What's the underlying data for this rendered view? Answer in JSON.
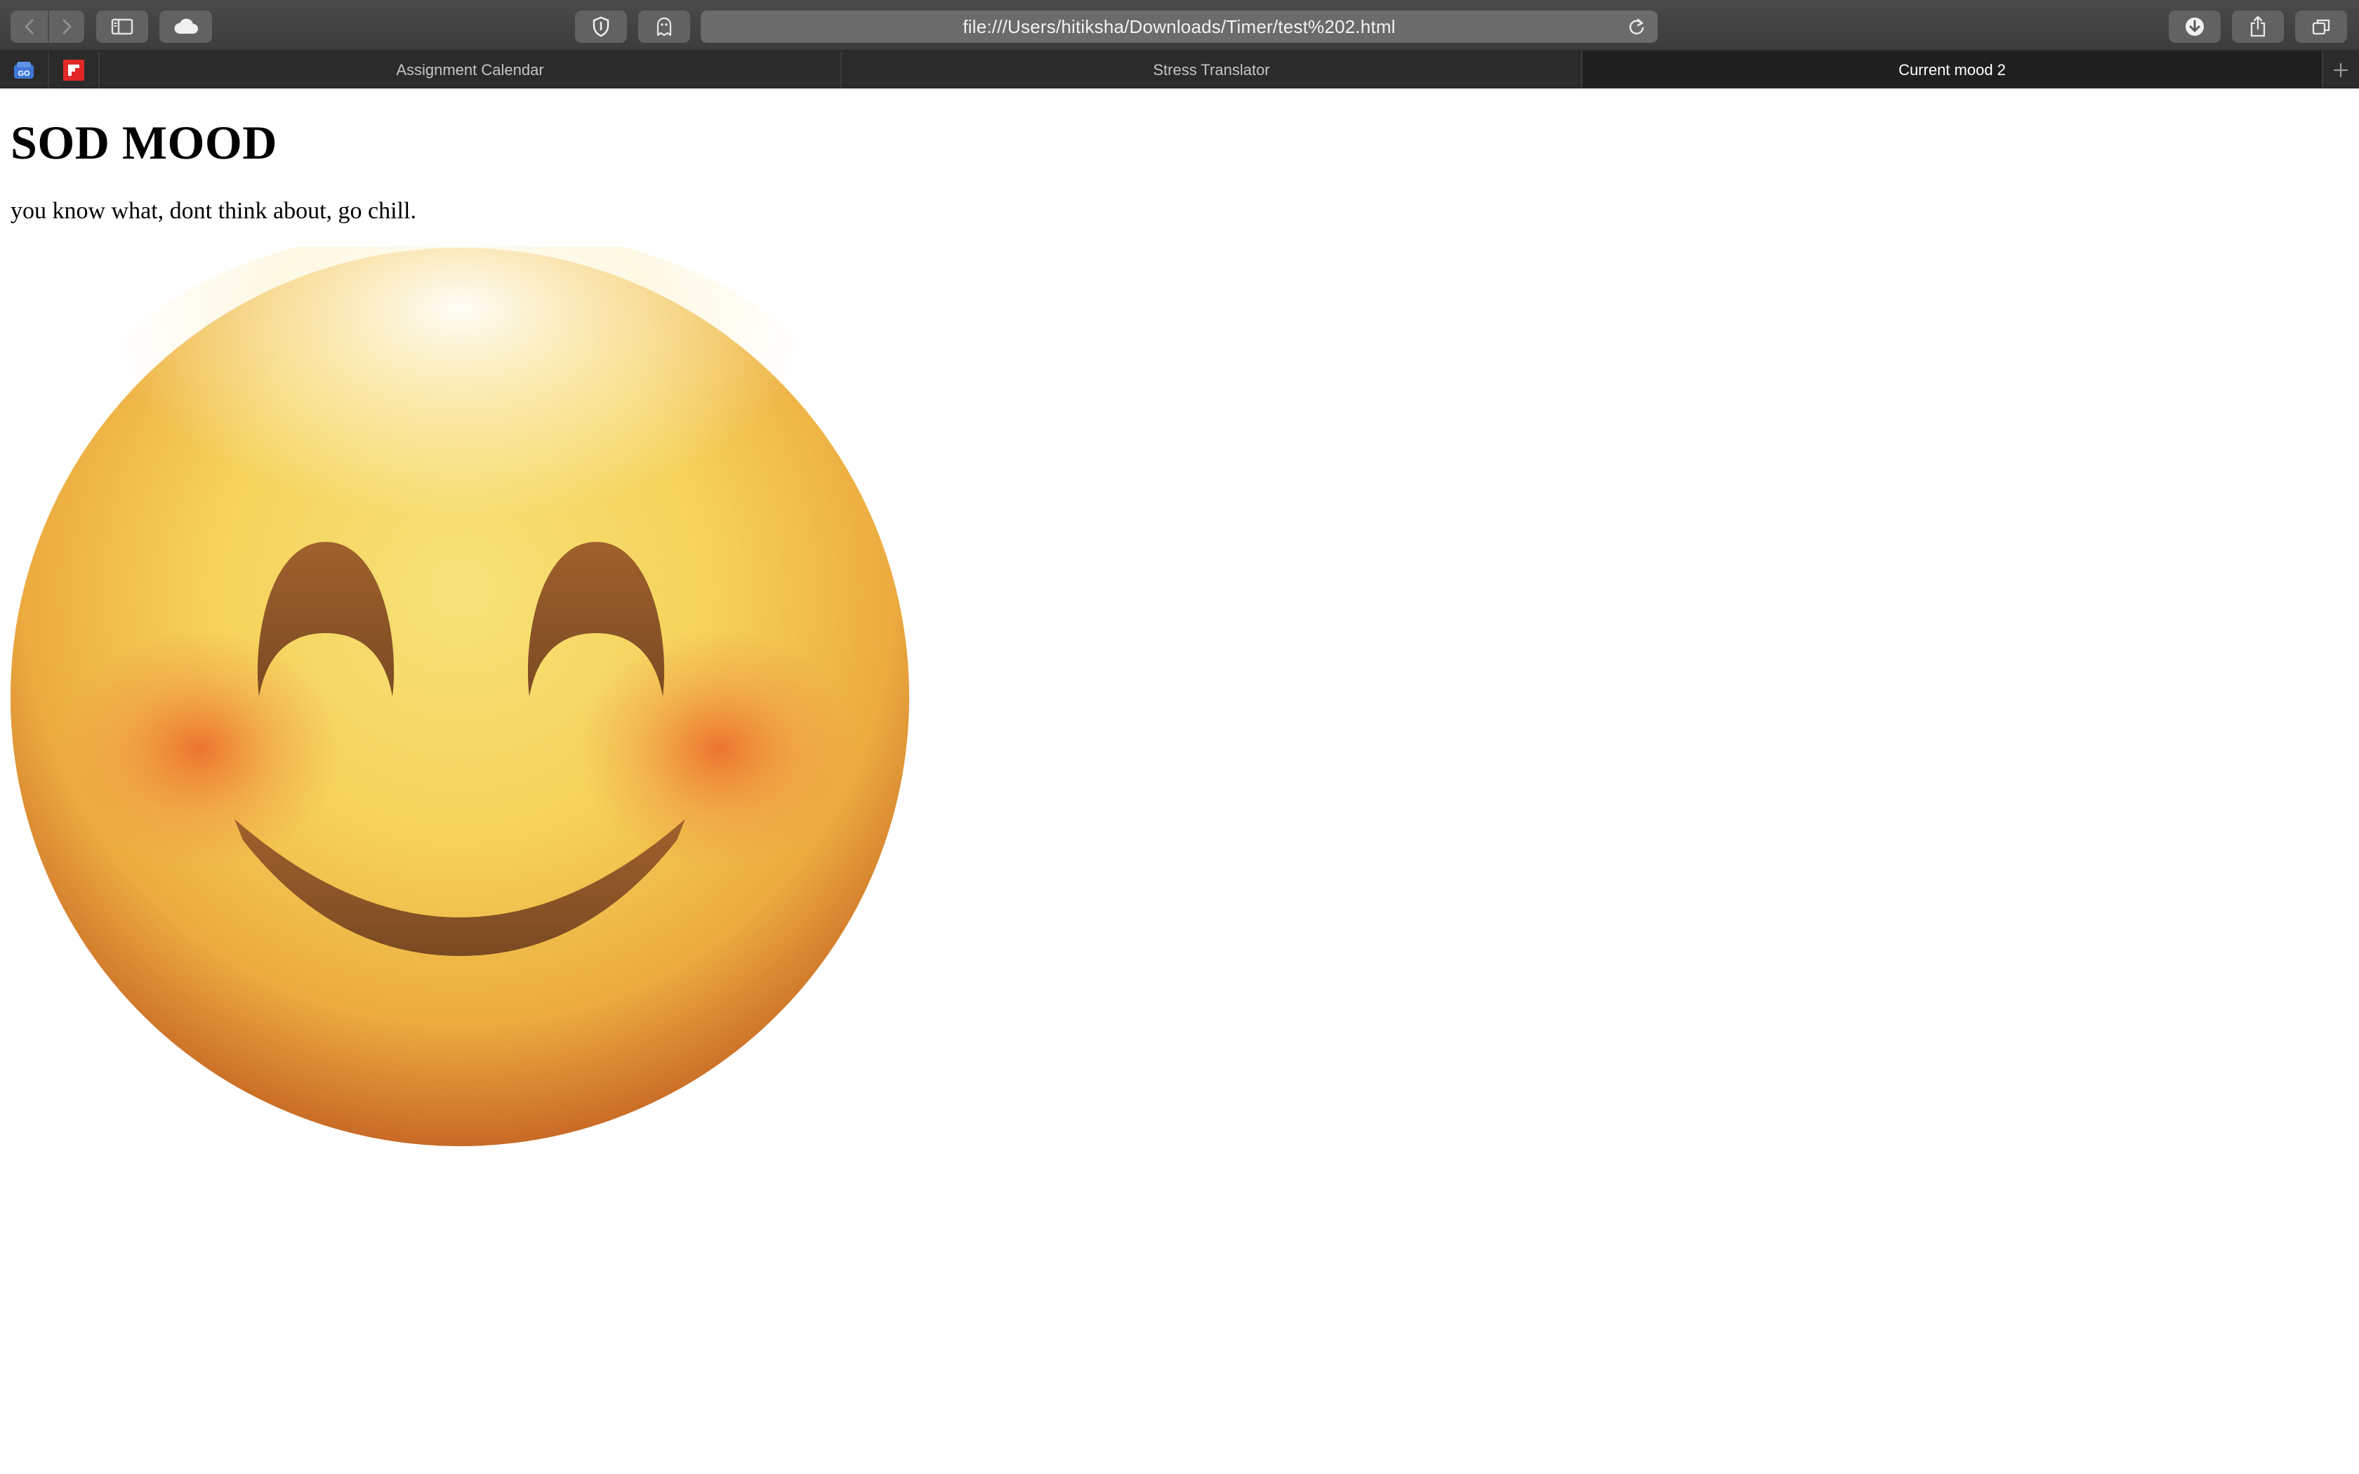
{
  "browser": {
    "url": "file:///Users/hitiksha/Downloads/Timer/test%202.html",
    "tabs": [
      {
        "label": "Assignment Calendar",
        "active": false
      },
      {
        "label": "Stress Translator",
        "active": false
      },
      {
        "label": "Current mood 2",
        "active": true
      }
    ],
    "icons": {
      "back": "chevron-left-icon",
      "forward": "chevron-right-icon",
      "sidebar": "sidebar-icon",
      "icloud": "cloud-icon",
      "privacy": "shield-icon",
      "extension": "ghost-icon",
      "reload": "reload-icon",
      "downloads": "download-icon",
      "share": "share-icon",
      "tab_overview": "tabs-overview-icon",
      "new_tab": "plus-icon"
    }
  },
  "page": {
    "heading": "SOD MOOD",
    "paragraph": "you know what, dont think about, go chill.",
    "image": "smiling-face-with-smiling-eyes-emoji"
  },
  "colors": {
    "toolbar": "#424242",
    "tabbar": "#2b2b2b",
    "active_tab": "#1f1f1f",
    "emoji_face": "#f4c545",
    "emoji_features": "#8a5426"
  }
}
